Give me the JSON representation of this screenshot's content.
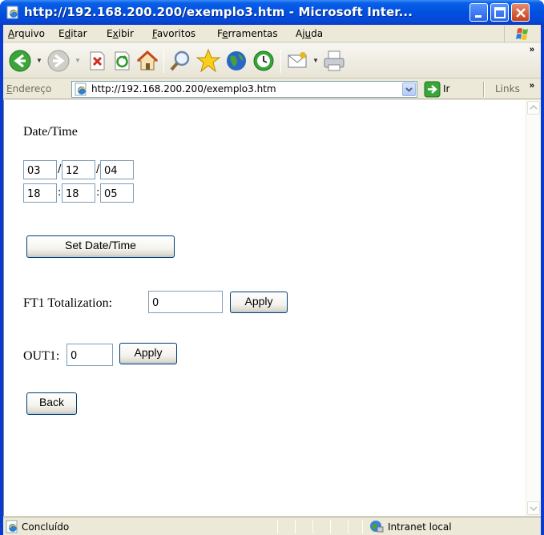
{
  "window": {
    "title": "http://192.168.200.200/exemplo3.htm - Microsoft Inter..."
  },
  "menu": {
    "items": [
      "Arquivo",
      "Editar",
      "Exibir",
      "Favoritos",
      "Ferramentas",
      "Ajuda"
    ]
  },
  "toolbar": {
    "icons": [
      "back-icon",
      "forward-icon",
      "stop-icon",
      "refresh-icon",
      "home-icon",
      "search-icon",
      "favorites-icon",
      "media-icon",
      "history-icon",
      "mail-icon",
      "print-icon"
    ],
    "more": "»"
  },
  "address": {
    "label": "Endereço",
    "url": "http://192.168.200.200/exemplo3.htm",
    "go_label": "Ir",
    "links_label": "Links",
    "more": "»"
  },
  "page": {
    "heading": "Date/Time",
    "date": {
      "day": "03",
      "month": "12",
      "year": "04",
      "separator": "/"
    },
    "time": {
      "hour": "18",
      "minute": "18",
      "second": "05",
      "separator": ":"
    },
    "set_button": "Set Date/Time",
    "ft1_label": "FT1 Totalization:",
    "ft1_value": "0",
    "ft1_apply": "Apply",
    "out1_label": "OUT1:",
    "out1_value": "0",
    "out1_apply": "Apply",
    "back_button": "Back"
  },
  "status": {
    "text": "Concluído",
    "zone": "Intranet local"
  },
  "colors": {
    "titlebar": "#0050e0",
    "chrome": "#ece9d8",
    "button_border": "#003c74",
    "input_border": "#7f9db9"
  }
}
